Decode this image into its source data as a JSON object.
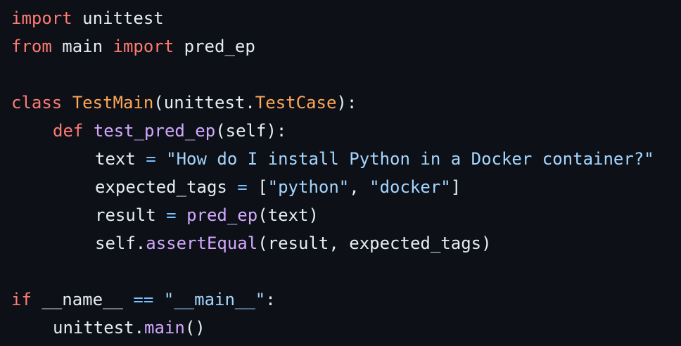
{
  "colors": {
    "background": "#0d1117",
    "keyword": "#ff7b72",
    "class_name": "#ffa657",
    "function": "#d2a8ff",
    "string": "#a5d6ff",
    "operator": "#79c0ff",
    "text": "#e6edf3"
  },
  "code": {
    "l1": {
      "kw": "import",
      "rest": " unittest"
    },
    "l2": {
      "kw1": "from",
      "mid": " main ",
      "kw2": "import",
      "rest": " pred_ep"
    },
    "l4": {
      "kw": "class",
      "sp": " ",
      "name": "TestMain",
      "open": "(unittest.",
      "base": "TestCase",
      "close": "):"
    },
    "l5": {
      "kw": "def",
      "sp": " ",
      "name": "test_pred_ep",
      "params": "(self):"
    },
    "l6": {
      "var": "text ",
      "op": "=",
      "sp": " ",
      "str": "\"How do I install Python in a Docker container?\""
    },
    "l7": {
      "var": "expected_tags ",
      "op": "=",
      "open": " [",
      "s1": "\"python\"",
      "comma": ", ",
      "s2": "\"docker\"",
      "close": "]"
    },
    "l8": {
      "var": "result ",
      "op": "=",
      "sp": " ",
      "fn": "pred_ep",
      "args": "(text)"
    },
    "l9": {
      "obj": "self.",
      "fn": "assertEqual",
      "args": "(result, expected_tags)"
    },
    "l11": {
      "kw": "if",
      "mid": " __name__ ",
      "op": "==",
      "sp": " ",
      "str": "\"__main__\"",
      "colon": ":"
    },
    "l12": {
      "obj": "unittest.",
      "fn": "main",
      "args": "()"
    }
  }
}
